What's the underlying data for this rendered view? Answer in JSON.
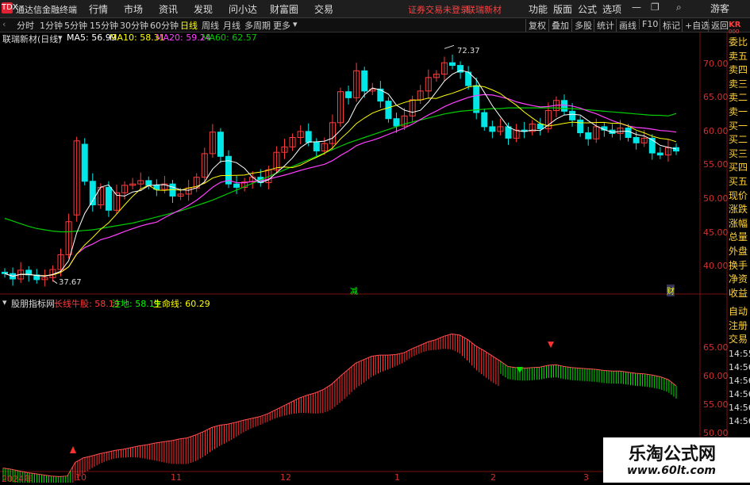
{
  "app": {
    "title": "通达信金融终端",
    "logo": "TDX"
  },
  "menu": [
    "行情",
    "市场",
    "资讯",
    "发现",
    "问小达",
    "财富圈",
    "交易"
  ],
  "warning": {
    "text": "证券交易未登录",
    "stock": "联瑞新材"
  },
  "right_menu": [
    "功能",
    "版面",
    "公式",
    "选项"
  ],
  "guest": "游客",
  "periods": [
    "分时",
    "1分钟",
    "5分钟",
    "15分钟",
    "30分钟",
    "60分钟",
    "日线",
    "周线",
    "月线",
    "多周期",
    "更多"
  ],
  "active_period": "日线",
  "tools": [
    "复权",
    "叠加",
    "多股",
    "统计",
    "画线",
    "F10",
    "标记",
    "+自选",
    "返回"
  ],
  "main_chart": {
    "stock_label": "联瑞新材(日线)",
    "ma5": "MA5: 56.99",
    "ma10": "MA10: 58.31",
    "ma20": "MA20: 59.24",
    "ma60": "MA60: 62.57",
    "high_marker": "72.37",
    "low_marker": "37.67",
    "y_ticks": [
      "70.00",
      "65.00",
      "60.00",
      "55.00",
      "50.00",
      "45.00",
      "40.00"
    ],
    "marker_1": "减",
    "marker_2": "财"
  },
  "sub_chart": {
    "name": "股朋指标网",
    "l1": "长线牛股: 58.19",
    "l2": "注地: 58.19",
    "l3": "生命线: 60.29",
    "y_ticks": [
      "65.00",
      "60.00",
      "55.00",
      "50.00"
    ]
  },
  "right_panel": {
    "code": "KR",
    "code_sub": "000",
    "items": [
      "委比",
      "卖五",
      "卖四",
      "卖三",
      "卖二",
      "卖一",
      "买一",
      "买二",
      "买三",
      "买四",
      "买五",
      "现价",
      "涨跌",
      "涨幅",
      "总量",
      "外盘",
      "换手",
      "净资",
      "收益"
    ],
    "items2": [
      "自动",
      "注册",
      "交易"
    ],
    "times": [
      "14:55",
      "14:56",
      "14:56",
      "14:56",
      "14:56",
      "14:56"
    ]
  },
  "x_labels": [
    "2024年",
    "10",
    "11",
    "12",
    "1",
    "2",
    "3"
  ],
  "colors": {
    "up": "#ff3b3b",
    "down": "#00e5e5",
    "ma5": "#ffffff",
    "ma10": "#ffff00",
    "ma20": "#ff40ff",
    "ma60": "#00cc00",
    "accent": "#ffd23c"
  },
  "watermark": {
    "title": "乐淘公式网",
    "url": "www.60lt.com"
  },
  "chart_data": {
    "type": "candlestick",
    "closes": [
      38.8,
      38.0,
      39.3,
      38.6,
      37.9,
      38.2,
      39.4,
      41.6,
      46.5,
      58.5,
      52.5,
      49.0,
      51.6,
      48.2,
      50.8,
      51.9,
      52.1,
      52.6,
      51.9,
      51.3,
      52.1,
      50.3,
      50.6,
      51.5,
      53.1,
      56.6,
      59.8,
      56.2,
      52.1,
      51.6,
      52.4,
      53.1,
      52.3,
      54.2,
      56.8,
      57.6,
      59.0,
      59.9,
      58.3,
      57.0,
      58.1,
      61.2,
      65.8,
      64.9,
      68.9,
      65.9,
      66.2,
      64.4,
      61.8,
      60.7,
      62.2,
      64.6,
      65.9,
      67.9,
      68.4,
      70.1,
      69.7,
      68.7,
      66.7,
      62.7,
      60.6,
      59.9,
      60.6,
      58.9,
      60.1,
      59.9,
      61.0,
      60.3,
      63.0,
      64.5,
      62.9,
      61.6,
      59.7,
      58.8,
      60.6,
      60.1,
      59.6,
      60.4,
      59.0,
      58.2,
      58.9,
      56.7,
      56.4,
      57.5,
      56.99
    ],
    "opens": [
      39.0,
      38.8,
      38.0,
      39.3,
      38.6,
      37.9,
      38.2,
      39.4,
      41.6,
      47.5,
      58.0,
      52.5,
      49.0,
      51.6,
      48.2,
      50.8,
      51.9,
      52.1,
      52.6,
      51.9,
      51.3,
      52.1,
      50.3,
      50.6,
      51.5,
      53.1,
      56.6,
      59.8,
      56.2,
      52.1,
      51.6,
      52.4,
      53.1,
      52.3,
      54.2,
      56.8,
      57.6,
      59.0,
      59.9,
      58.3,
      57.0,
      58.1,
      61.2,
      65.8,
      64.9,
      68.9,
      65.9,
      66.2,
      64.4,
      61.8,
      60.7,
      62.2,
      64.6,
      65.9,
      67.9,
      68.4,
      70.1,
      69.7,
      68.7,
      66.7,
      62.7,
      60.6,
      59.9,
      60.6,
      58.9,
      60.1,
      59.9,
      61.0,
      60.3,
      63.0,
      64.5,
      62.9,
      61.6,
      59.7,
      58.8,
      60.6,
      60.1,
      59.6,
      60.4,
      59.0,
      58.2,
      58.9,
      56.7,
      56.4,
      57.5
    ],
    "ma60": [
      47.0,
      46.6,
      46.2,
      45.8,
      45.5,
      45.3,
      45.1,
      45.0,
      45.0,
      45.1,
      45.2,
      45.3,
      45.5,
      45.7,
      45.9,
      46.1,
      46.3,
      46.6,
      46.9,
      47.2,
      47.5,
      47.8,
      48.1,
      48.5,
      48.9,
      49.3,
      49.7,
      50.2,
      50.7,
      51.2,
      51.7,
      52.2,
      52.7,
      53.2,
      53.7,
      54.2,
      54.7,
      55.2,
      55.7,
      56.2,
      56.7,
      57.2,
      57.7,
      58.2,
      58.6,
      59.0,
      59.4,
      59.8,
      60.2,
      60.6,
      61.0,
      61.3,
      61.6,
      61.9,
      62.2,
      62.5,
      62.7,
      62.9,
      63.0,
      63.1,
      63.2,
      63.3,
      63.3,
      63.4,
      63.4,
      63.4,
      63.4,
      63.4,
      63.4,
      63.4,
      63.3,
      63.3,
      63.2,
      63.1,
      63.0,
      62.9,
      62.8,
      62.7,
      62.6,
      62.5,
      62.4,
      62.3,
      62.3,
      62.2,
      62.57
    ],
    "ylim": [
      37,
      75
    ],
    "sub_values": [
      43.8,
      43.6,
      43.3,
      43.0,
      42.8,
      42.6,
      42.4,
      42.3,
      42.4,
      44.8,
      45.6,
      45.9,
      46.3,
      46.6,
      46.9,
      47.1,
      47.4,
      47.7,
      47.9,
      48.2,
      48.4,
      48.6,
      48.9,
      49.1,
      49.6,
      50.2,
      50.9,
      51.3,
      51.5,
      51.8,
      52.2,
      52.5,
      52.8,
      53.3,
      54.0,
      54.7,
      55.4,
      56.1,
      56.6,
      57.0,
      57.6,
      58.5,
      59.8,
      61.0,
      62.2,
      62.8,
      63.4,
      63.6,
      63.6,
      63.7,
      64.0,
      64.7,
      65.3,
      65.9,
      66.3,
      66.9,
      67.3,
      67.1,
      66.3,
      65.2,
      64.4,
      63.5,
      62.6,
      61.6,
      61.4,
      61.3,
      61.4,
      61.5,
      61.8,
      61.9,
      61.6,
      61.4,
      61.3,
      61.2,
      61.1,
      60.9,
      60.8,
      60.8,
      60.6,
      60.4,
      60.3,
      60.1,
      59.8,
      59.3,
      58.19
    ],
    "sub_ylim": [
      40,
      69
    ],
    "x_ticks": [
      "2024年",
      "10",
      "11",
      "12",
      "1",
      "2",
      "3"
    ]
  }
}
